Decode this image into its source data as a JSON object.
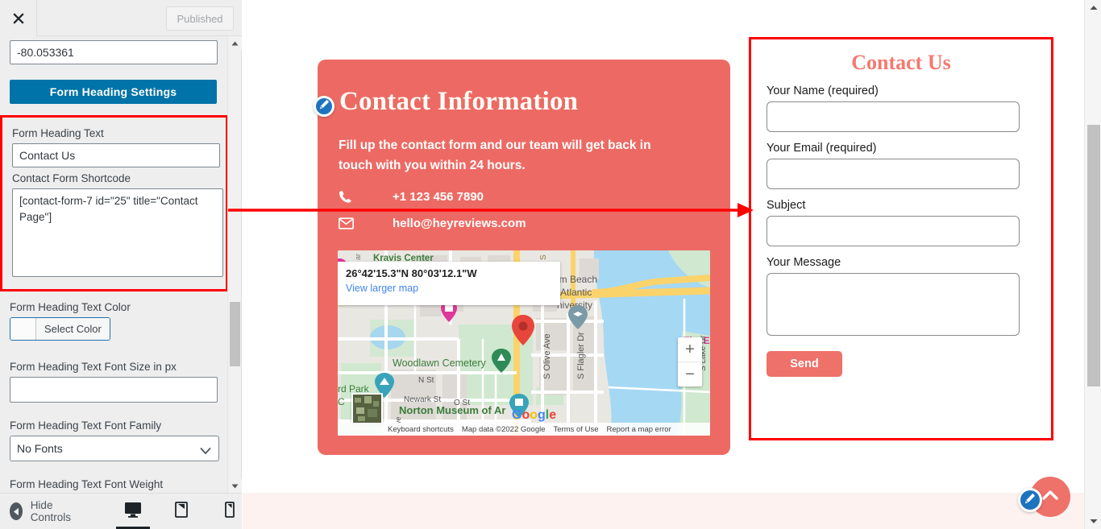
{
  "sidebar": {
    "close_icon": "close-icon",
    "published_label": "Published",
    "coordinate_value": "-80.053361",
    "section_button_label": "Form Heading Settings",
    "heading_text_label": "Form Heading Text",
    "heading_text_value": "Contact Us",
    "shortcode_label": "Contact Form Shortcode",
    "shortcode_value": "[contact-form-7 id=\"25\" title=\"Contact Page\"]",
    "color_label": "Form Heading Text Color",
    "select_color_label": "Select Color",
    "font_size_label": "Form Heading Text Font Size in px",
    "font_size_value": "",
    "font_family_label": "Form Heading Text Font Family",
    "font_family_value": "No Fonts",
    "font_weight_label": "Form Heading Text Font Weight",
    "footer": {
      "hide_controls_label": "Hide Controls",
      "devices": [
        "desktop",
        "tablet",
        "mobile"
      ],
      "active_device": "desktop"
    },
    "accent_blue": "#0073a8"
  },
  "preview": {
    "info_card": {
      "title": "Contact Information",
      "subtitle": "Fill up the contact form and our team will get back in touch with you within 24 hours.",
      "phone": "+1 123 456 7890",
      "email": "hello@heyreviews.com",
      "bg_color": "#ed6a64"
    },
    "map": {
      "coordinates": "26°42'15.3\"N 80°03'12.1\"W",
      "view_larger_label": "View larger map",
      "zoom_in_label": "+",
      "zoom_out_label": "−",
      "brand": "Google",
      "footer_items": [
        "Keyboard shortcuts",
        "Map data ©2022 Google",
        "Terms of Use",
        "Report a map error"
      ],
      "place_labels": [
        "Kravis Center",
        "Palm Beach",
        "Atlantic",
        "University",
        "Woodlawn Cemetery",
        "N St",
        "Newark St",
        "O St",
        "Norton Museum of Ar",
        "S Olive Ave",
        "S Flagler Dr",
        "S Lake Dr",
        "The E",
        "rd Park",
        "Ave"
      ]
    },
    "form": {
      "title": "Contact Us",
      "fields": [
        {
          "label": "Your Name (required)",
          "value": "",
          "type": "text"
        },
        {
          "label": "Your Email (required)",
          "value": "",
          "type": "text"
        },
        {
          "label": "Subject",
          "value": "",
          "type": "text"
        },
        {
          "label": "Your Message",
          "value": "",
          "type": "textarea"
        }
      ],
      "send_label": "Send",
      "accent_color": "#ee716a",
      "border_color": "#ff0000"
    },
    "fab": {
      "scroll_top_icon": "chevron-up-icon",
      "edit_icon": "pencil-icon"
    }
  }
}
